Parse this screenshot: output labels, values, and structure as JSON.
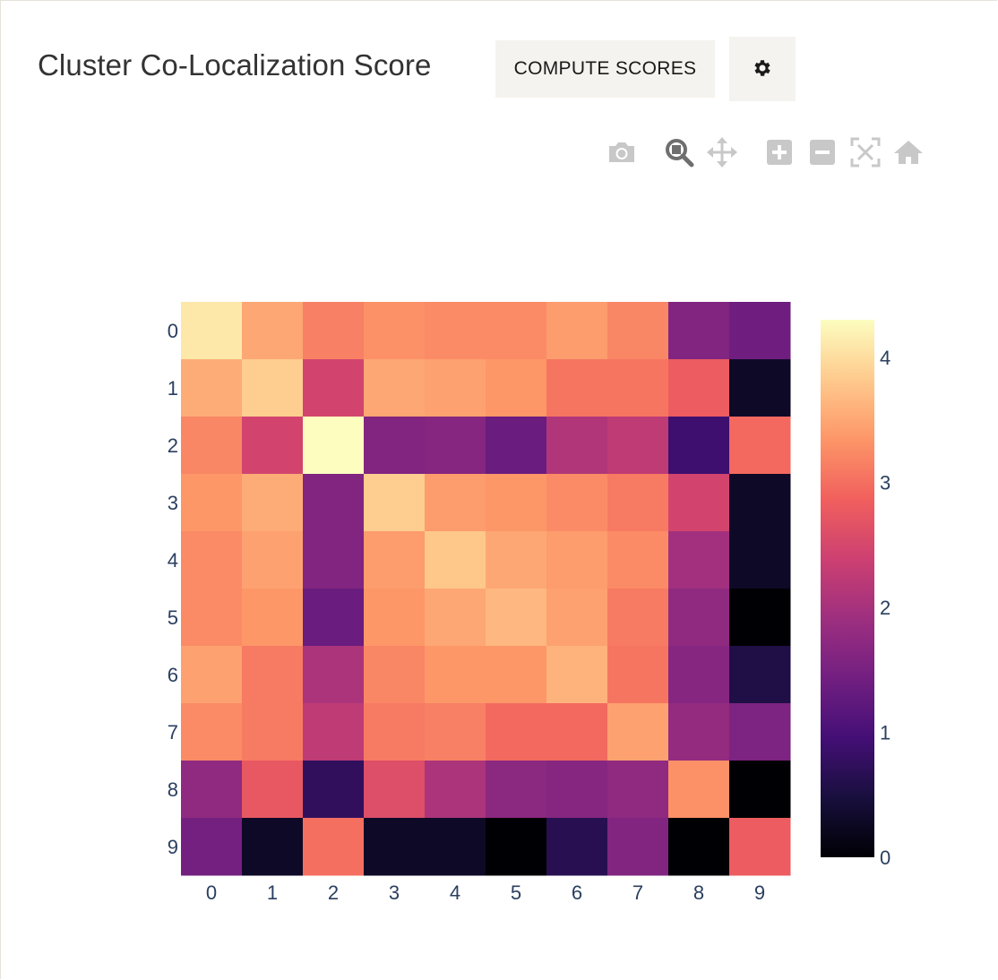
{
  "header": {
    "title": "Cluster Co-Localization Score",
    "compute_label": "COMPUTE SCORES",
    "settings_icon": "gear-icon"
  },
  "modebar": {
    "icons": [
      "camera-icon",
      "zoom-icon",
      "pan-icon",
      "zoom-in-icon",
      "zoom-out-icon",
      "autoscale-icon",
      "home-icon"
    ],
    "active": "zoom-icon"
  },
  "chart_data": {
    "type": "heatmap",
    "colorscale": "magma",
    "x": [
      "0",
      "1",
      "2",
      "3",
      "4",
      "5",
      "6",
      "7",
      "8",
      "9"
    ],
    "y": [
      "0",
      "1",
      "2",
      "3",
      "4",
      "5",
      "6",
      "7",
      "8",
      "9"
    ],
    "zmin": 0,
    "zmax": 4.3,
    "z": [
      [
        4.1,
        3.5,
        3.15,
        3.3,
        3.25,
        3.25,
        3.4,
        3.2,
        1.6,
        1.4
      ],
      [
        3.55,
        3.85,
        2.45,
        3.5,
        3.45,
        3.35,
        3.05,
        3.05,
        2.8,
        0.3
      ],
      [
        3.2,
        2.45,
        4.3,
        1.6,
        1.65,
        1.35,
        2.1,
        2.25,
        0.9,
        2.95
      ],
      [
        3.35,
        3.55,
        1.6,
        3.85,
        3.4,
        3.35,
        3.25,
        3.1,
        2.45,
        0.3
      ],
      [
        3.25,
        3.45,
        1.6,
        3.4,
        3.8,
        3.5,
        3.4,
        3.25,
        1.95,
        0.3
      ],
      [
        3.25,
        3.35,
        1.35,
        3.35,
        3.5,
        3.65,
        3.45,
        3.1,
        1.75,
        0.0
      ],
      [
        3.45,
        3.1,
        2.05,
        3.2,
        3.35,
        3.35,
        3.6,
        3.05,
        1.65,
        0.55
      ],
      [
        3.25,
        3.1,
        2.25,
        3.1,
        3.15,
        2.95,
        2.95,
        3.45,
        1.8,
        1.55
      ],
      [
        1.75,
        2.75,
        0.75,
        2.6,
        2.05,
        1.7,
        1.65,
        1.75,
        3.3,
        0.0
      ],
      [
        1.45,
        0.3,
        3.0,
        0.3,
        0.3,
        0.0,
        0.65,
        1.6,
        0.0,
        2.8
      ]
    ],
    "colorbar": {
      "ticks": [
        0,
        1,
        2,
        3,
        4
      ],
      "tick_labels": [
        "0",
        "1",
        "2",
        "3",
        "4"
      ]
    },
    "title": "",
    "xlabel": "",
    "ylabel": ""
  }
}
